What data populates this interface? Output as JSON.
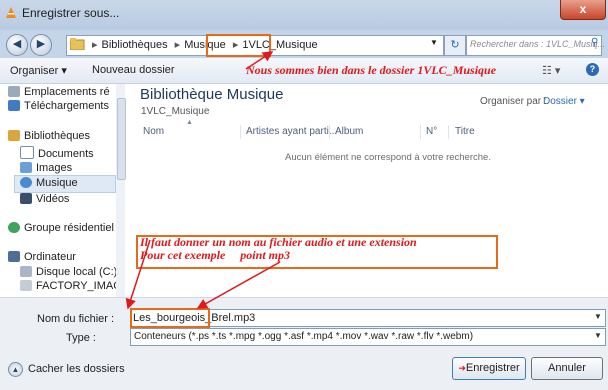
{
  "window": {
    "title": "Enregistrer sous...",
    "close_glyph": "x"
  },
  "address": {
    "crumbs": [
      "Bibliothèques",
      "Musique",
      "1VLC_Musique"
    ],
    "search_placeholder": "Rechercher dans : 1VLC_Musiq..."
  },
  "toolbar": {
    "organize": "Organiser ▾",
    "new_folder": "Nouveau dossier",
    "view_glyph": "☷ ▾",
    "help_glyph": "?"
  },
  "annotations": {
    "top": "Nous sommes bien dans le dossier 1VLC_Musique",
    "bottom_line1": "Il faut donner un nom au fichier audio et une extension",
    "bottom_line2": "Pour cet exemple     point mp3"
  },
  "sidebar": {
    "items": [
      {
        "label": "Emplacements ré",
        "icon": "recent-places-icon"
      },
      {
        "label": "Téléchargements",
        "icon": "downloads-icon"
      },
      {
        "label": "Bibliothèques",
        "icon": "libraries-icon"
      },
      {
        "label": "Documents",
        "icon": "documents-icon"
      },
      {
        "label": "Images",
        "icon": "images-icon"
      },
      {
        "label": "Musique",
        "icon": "music-icon",
        "selected": true
      },
      {
        "label": "Vidéos",
        "icon": "videos-icon"
      },
      {
        "label": "Groupe résidentiel",
        "icon": "homegroup-icon"
      },
      {
        "label": "Ordinateur",
        "icon": "computer-icon"
      },
      {
        "label": "Disque local (C:)",
        "icon": "local-disk-icon"
      },
      {
        "label": "FACTORY_IMAGI",
        "icon": "drive-icon"
      }
    ]
  },
  "library": {
    "title": "Bibliothèque Musique",
    "subtitle": "1VLC_Musique",
    "arrange_label": "Organiser par :",
    "arrange_value": "Dossier ▾",
    "columns": [
      "Nom",
      "Artistes ayant parti...",
      "Album",
      "N°",
      "Titre"
    ],
    "empty_message": "Aucun élément ne correspond à votre recherche."
  },
  "form": {
    "filename_label": "Nom du fichier :",
    "filename_value": "Les_bourgeois_Brel.mp3",
    "type_label": "Type :",
    "type_value": "Conteneurs (*.ps *.ts *.mpg *.ogg *.asf *.mp4 *.mov *.wav *.raw *.flv *.webm)"
  },
  "footer": {
    "hide_folders": "Cacher les dossiers",
    "save": "Enregistrer",
    "cancel": "Annuler"
  },
  "colors": {
    "annotation": "#e0191b",
    "highlight_box": "#e36b1a",
    "accent": "#1e395b"
  }
}
